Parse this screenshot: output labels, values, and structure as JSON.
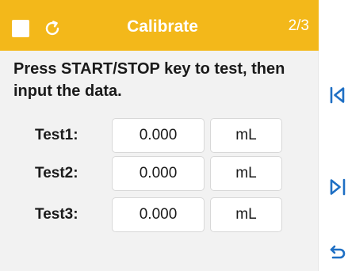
{
  "header": {
    "title": "Calibrate",
    "page": "2/3",
    "icons": [
      "checkbox-square-icon",
      "refresh-icon"
    ],
    "color": "#f3b81a"
  },
  "instruction": "Press START/STOP key to test, then input the data.",
  "rows": [
    {
      "label": "Test1:",
      "value": "0.000",
      "unit": "mL"
    },
    {
      "label": "Test2:",
      "value": "0.000",
      "unit": "mL"
    },
    {
      "label": "Test3:",
      "value": "0.000",
      "unit": "mL"
    }
  ],
  "side_controls": [
    "skip-to-start-icon",
    "skip-to-end-icon",
    "back-icon"
  ],
  "accent_color": "#1e6fc4"
}
